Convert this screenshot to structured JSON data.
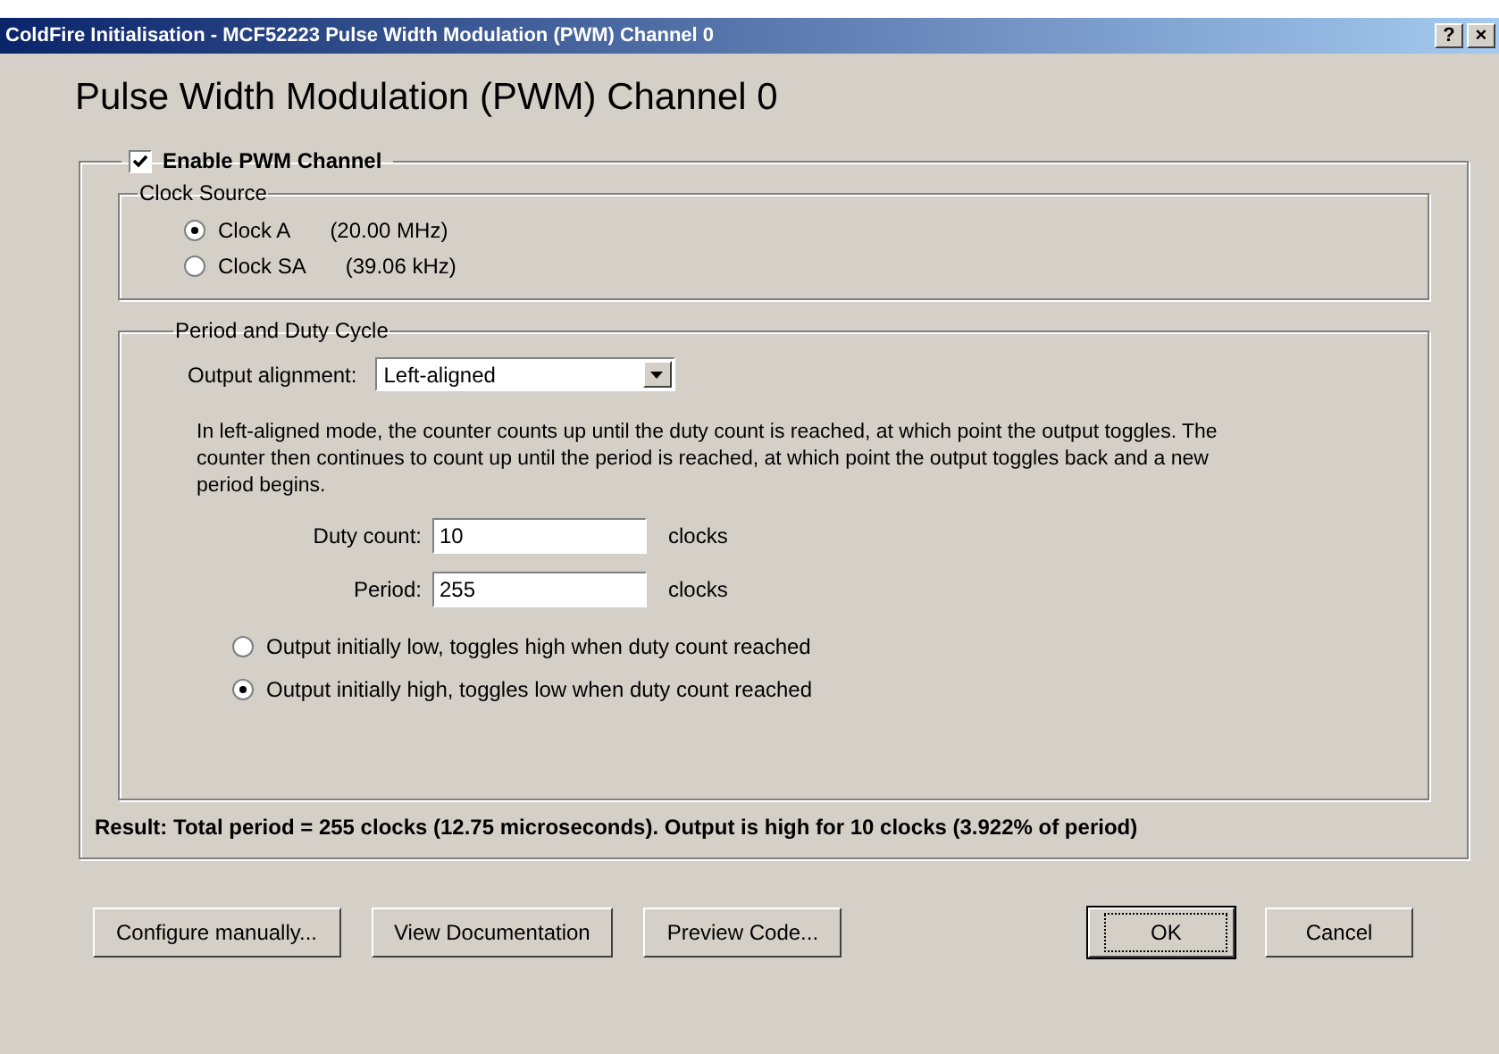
{
  "window": {
    "title": "ColdFire Initialisation - MCF52223 Pulse Width Modulation (PWM) Channel 0",
    "title_buttons": [
      "?",
      "×"
    ]
  },
  "heading": "Pulse Width Modulation (PWM) Channel 0",
  "enable": {
    "label": "Enable PWM Channel",
    "checked": true
  },
  "clock_source": {
    "title": "Clock Source",
    "options": [
      {
        "label": "Clock A",
        "value": "(20.00 MHz)",
        "selected": true
      },
      {
        "label": "Clock SA",
        "value": "(39.06 kHz)",
        "selected": false
      }
    ]
  },
  "period_duty": {
    "title": "Period and Duty Cycle",
    "alignment": {
      "label": "Output alignment:",
      "value": "Left-aligned"
    },
    "description": "In left-aligned mode, the counter counts up until the duty count is reached, at which point the output toggles. The counter then continues to count up until the period is reached, at which point the output toggles back and a new period begins.",
    "fields": [
      {
        "label": "Duty count:",
        "value": "10",
        "unit": "clocks"
      },
      {
        "label": "Period:",
        "value": "255",
        "unit": "clocks"
      }
    ],
    "polarity": [
      {
        "label": "Output initially low, toggles high when duty count reached",
        "selected": false
      },
      {
        "label": "Output initially high, toggles low when duty count reached",
        "selected": true
      }
    ],
    "result": "Result: Total period = 255 clocks (12.75 microseconds). Output is high for 10 clocks (3.922% of period)"
  },
  "buttons_left": [
    "Configure manually...",
    "View Documentation",
    "Preview Code..."
  ],
  "buttons_right": [
    {
      "label": "OK",
      "default": true
    },
    {
      "label": "Cancel",
      "default": false
    }
  ]
}
